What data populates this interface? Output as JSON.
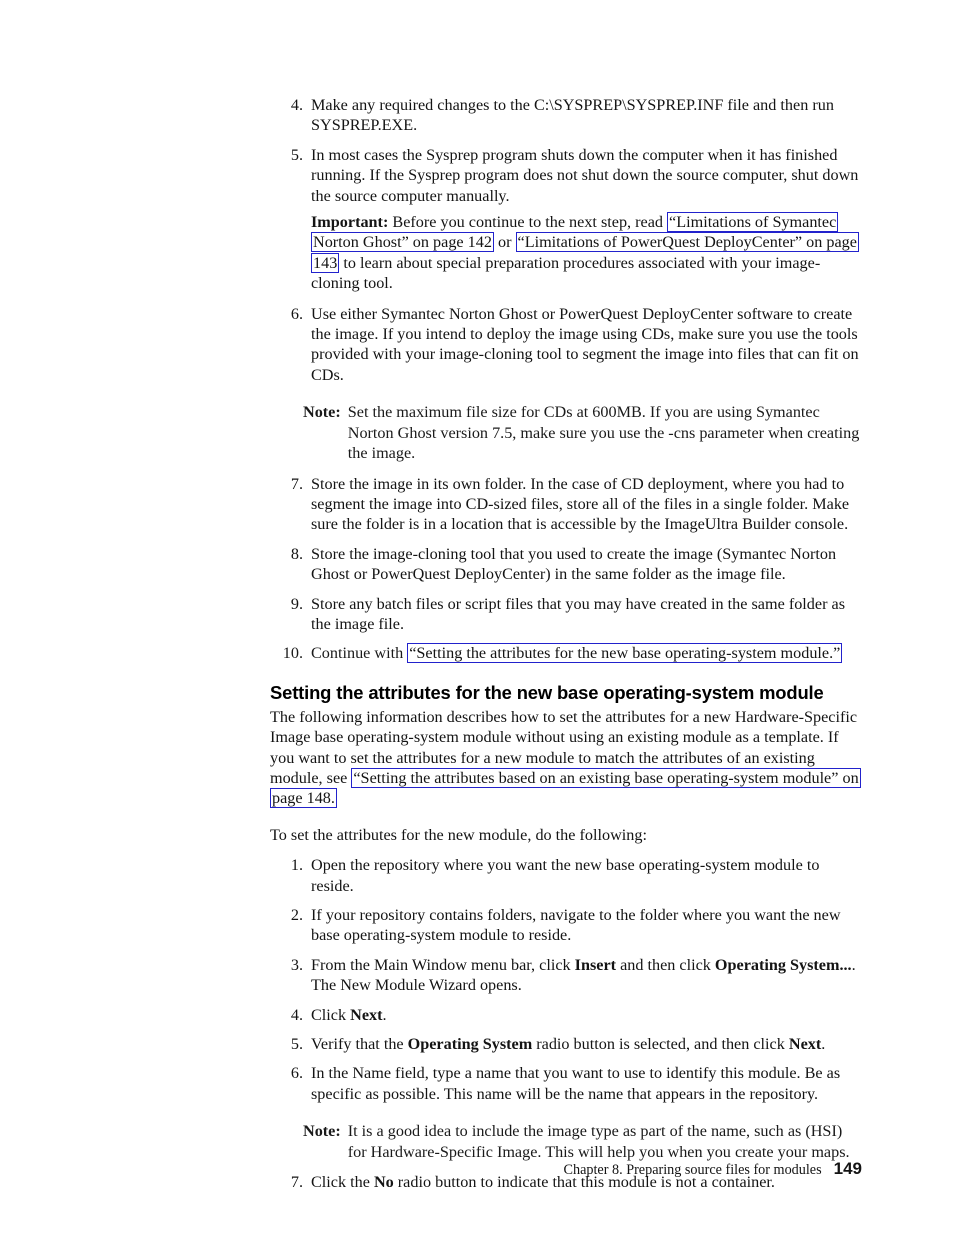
{
  "document": {
    "type": "pdf-page",
    "page_number": "149",
    "footer_chapter": "Chapter 8. Preparing source files for modules",
    "link_box_color": "#2222cc",
    "text_color": "#141414",
    "background_color": "#ffffff"
  },
  "list_one": {
    "items": [
      {
        "number": "4.",
        "text": "Make any required changes to the C:\\SYSPREP\\SYSPREP.INF file and then run SYSPREP.EXE."
      },
      {
        "number": "5.",
        "text": "In most cases the Sysprep program shuts down the computer when it has finished running. If the Sysprep program does not shut down the source computer, shut down the source computer manually.",
        "important": {
          "label": "Important:",
          "before": " Before you continue to the next step, read ",
          "link1": "“Limitations of Symantec Norton Ghost” on page 142",
          "between": " or ",
          "link2": "“Limitations of PowerQuest DeployCenter” on page 143",
          "after": " to learn about special preparation procedures associated with your image-cloning tool."
        }
      },
      {
        "number": "6.",
        "text": "Use either Symantec Norton Ghost or PowerQuest DeployCenter software to create the image. If you intend to deploy the image using CDs, make sure you use the tools provided with your image-cloning tool to segment the image into files that can fit on CDs."
      }
    ],
    "note_one": {
      "label": "Note:",
      "text": "Set the maximum file size for CDs at 600MB. If you are using Symantec Norton Ghost version 7.5, make sure you use the -cns parameter when creating the image."
    },
    "items_cont": [
      {
        "number": "7.",
        "text": "Store the image in its own folder. In the case of CD deployment, where you had to segment the image into CD-sized files, store all of the files in a single folder. Make sure the folder is in a location that is accessible by the ImageUltra Builder console."
      },
      {
        "number": "8.",
        "text": "Store the image-cloning tool that you used to create the image (Symantec Norton Ghost or PowerQuest DeployCenter) in the same folder as the image file."
      },
      {
        "number": "9.",
        "text": "Store any batch files or script files that you may have created in the same folder as the image file."
      }
    ],
    "item_ten": {
      "number": "10.",
      "before": "Continue with ",
      "link": "“Setting the attributes for the new base operating-system module.”"
    }
  },
  "section": {
    "heading": "Setting the attributes for the new base operating-system module",
    "intro": {
      "before": "The following information describes how to set the attributes for a new Hardware-Specific Image base operating-system module without using an existing module as a template. If you want to set the attributes for a new module to match the attributes of an existing module, see ",
      "link": "“Setting the attributes based on an existing base operating-system module” on page 148.",
      "after": ""
    },
    "lead_in": "To set the attributes for the new module, do the following:",
    "steps": [
      {
        "number": "1.",
        "parts": [
          {
            "t": "Open the repository where you want the new base operating-system module to reside.",
            "b": false
          }
        ]
      },
      {
        "number": "2.",
        "parts": [
          {
            "t": "If your repository contains folders, navigate to the folder where you want the new base operating-system module to reside.",
            "b": false
          }
        ]
      },
      {
        "number": "3.",
        "parts": [
          {
            "t": "From the Main Window menu bar, click ",
            "b": false
          },
          {
            "t": "Insert",
            "b": true
          },
          {
            "t": " and then click ",
            "b": false
          },
          {
            "t": "Operating System...",
            "b": true
          },
          {
            "t": ". The New Module Wizard opens.",
            "b": false
          }
        ]
      },
      {
        "number": "4.",
        "parts": [
          {
            "t": "Click ",
            "b": false
          },
          {
            "t": "Next",
            "b": true
          },
          {
            "t": ".",
            "b": false
          }
        ]
      },
      {
        "number": "5.",
        "parts": [
          {
            "t": "Verify that the ",
            "b": false
          },
          {
            "t": "Operating System",
            "b": true
          },
          {
            "t": " radio button is selected, and then click ",
            "b": false
          },
          {
            "t": "Next",
            "b": true
          },
          {
            "t": ".",
            "b": false
          }
        ]
      },
      {
        "number": "6.",
        "parts": [
          {
            "t": "In the Name field, type a name that you want to use to identify this module. Be as specific as possible. This name will be the name that appears in the repository.",
            "b": false
          }
        ]
      }
    ],
    "note_two": {
      "label": "Note:",
      "text": "It is a good idea to include the image type as part of the name, such as (HSI) for Hardware-Specific Image. This will help you when you create your maps."
    },
    "step_seven": {
      "number": "7.",
      "parts": [
        {
          "t": "Click the ",
          "b": false
        },
        {
          "t": "No",
          "b": true
        },
        {
          "t": " radio button to indicate that this module is not a container.",
          "b": false
        }
      ]
    }
  }
}
